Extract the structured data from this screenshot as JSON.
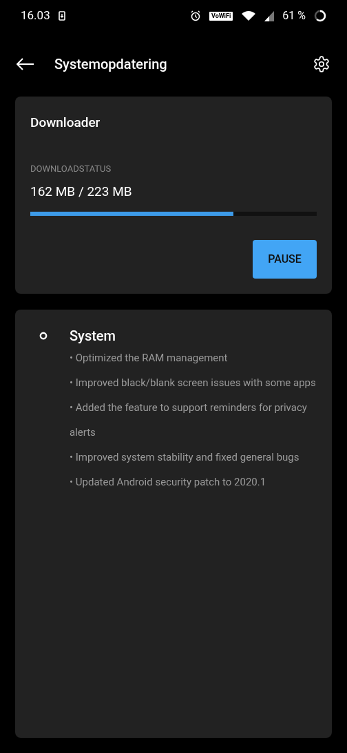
{
  "status_bar": {
    "time": "16.03",
    "vowifi": "VoWiFi",
    "battery": "61 %"
  },
  "app_bar": {
    "title": "Systemopdatering"
  },
  "download_card": {
    "title": "Downloader",
    "status_label": "DOWNLOADSTATUS",
    "progress_text": "162 MB / 223 MB",
    "level": 0.71,
    "button": "PAUSE"
  },
  "changelog": {
    "title": "System",
    "items": [
      "• Optimized the RAM management",
      "• Improved black/blank screen issues with some apps",
      "• Added the feature to support reminders for privacy alerts",
      "• Improved system stability and fixed general bugs",
      "• Updated Android security patch to 2020.1"
    ]
  }
}
